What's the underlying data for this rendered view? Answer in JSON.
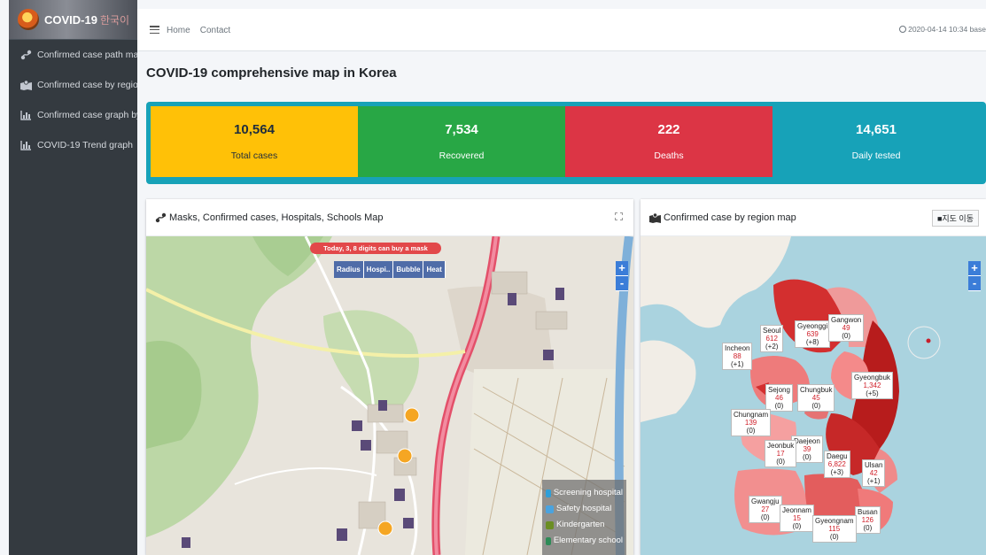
{
  "brand": {
    "title": "COVID-19",
    "subtitle": "한국이"
  },
  "sidebar": {
    "items": [
      {
        "label": "Confirmed case path map"
      },
      {
        "label": "Confirmed case by region m"
      },
      {
        "label": "Confirmed case graph by reg"
      },
      {
        "label": "COVID-19 Trend graph"
      }
    ]
  },
  "header": {
    "home": "Home",
    "contact": "Contact",
    "updated": "2020-04-14 10:34 base"
  },
  "page_title": "COVID-19 comprehensive map in Korea",
  "stats": {
    "total": {
      "value": "10,564",
      "label": "Total cases"
    },
    "recovered": {
      "value": "7,534",
      "label": "Recovered"
    },
    "deaths": {
      "value": "222",
      "label": "Deaths"
    },
    "tested": {
      "value": "14,651",
      "label": "Daily tested"
    }
  },
  "left_card": {
    "title": "Masks, Confirmed cases, Hospitals, Schools Map",
    "banner": "Today, 3, 8 digits can buy a mask",
    "modes": [
      "Radius",
      "Hospi..",
      "Bubble",
      "Heat"
    ],
    "legend": [
      {
        "label": "Screening hospital",
        "color": "#2f9fd8"
      },
      {
        "label": "Safety hospital",
        "color": "#4aa3df"
      },
      {
        "label": "Kindergarten",
        "color": "#6b8e23"
      },
      {
        "label": "Elementary school",
        "color": "#2e8b57"
      }
    ],
    "zoom_in": "+",
    "zoom_out": "-"
  },
  "right_card": {
    "title": "Confirmed case by region map",
    "move_button": "■지도 이동",
    "zoom_in": "+",
    "zoom_out": "-",
    "regions": [
      {
        "name": "Seoul",
        "value": "612",
        "change": "(+2)"
      },
      {
        "name": "Gyeonggi",
        "value": "639",
        "change": "(+8)"
      },
      {
        "name": "Gangwon",
        "value": "49",
        "change": "(0)"
      },
      {
        "name": "Incheon",
        "value": "88",
        "change": "(+1)"
      },
      {
        "name": "Gyeongbuk",
        "value": "1,342",
        "change": "(+5)"
      },
      {
        "name": "Sejong",
        "value": "46",
        "change": "(0)"
      },
      {
        "name": "Chungbuk",
        "value": "45",
        "change": "(0)"
      },
      {
        "name": "Chungnam",
        "value": "139",
        "change": "(0)"
      },
      {
        "name": "Daejeon",
        "value": "39",
        "change": "(0)"
      },
      {
        "name": "Jeonbuk",
        "value": "17",
        "change": "(0)"
      },
      {
        "name": "Daegu",
        "value": "6,822",
        "change": "(+3)"
      },
      {
        "name": "Ulsan",
        "value": "42",
        "change": "(+1)"
      },
      {
        "name": "Gwangju",
        "value": "27",
        "change": "(0)"
      },
      {
        "name": "Jeonnam",
        "value": "15",
        "change": "(0)"
      },
      {
        "name": "Busan",
        "value": "126",
        "change": "(0)"
      },
      {
        "name": "Gyeongnam",
        "value": "115",
        "change": "(0)"
      }
    ]
  },
  "colors": {
    "yellow": "#ffc107",
    "green": "#28a745",
    "red": "#dc3545",
    "teal": "#17a2b8"
  }
}
